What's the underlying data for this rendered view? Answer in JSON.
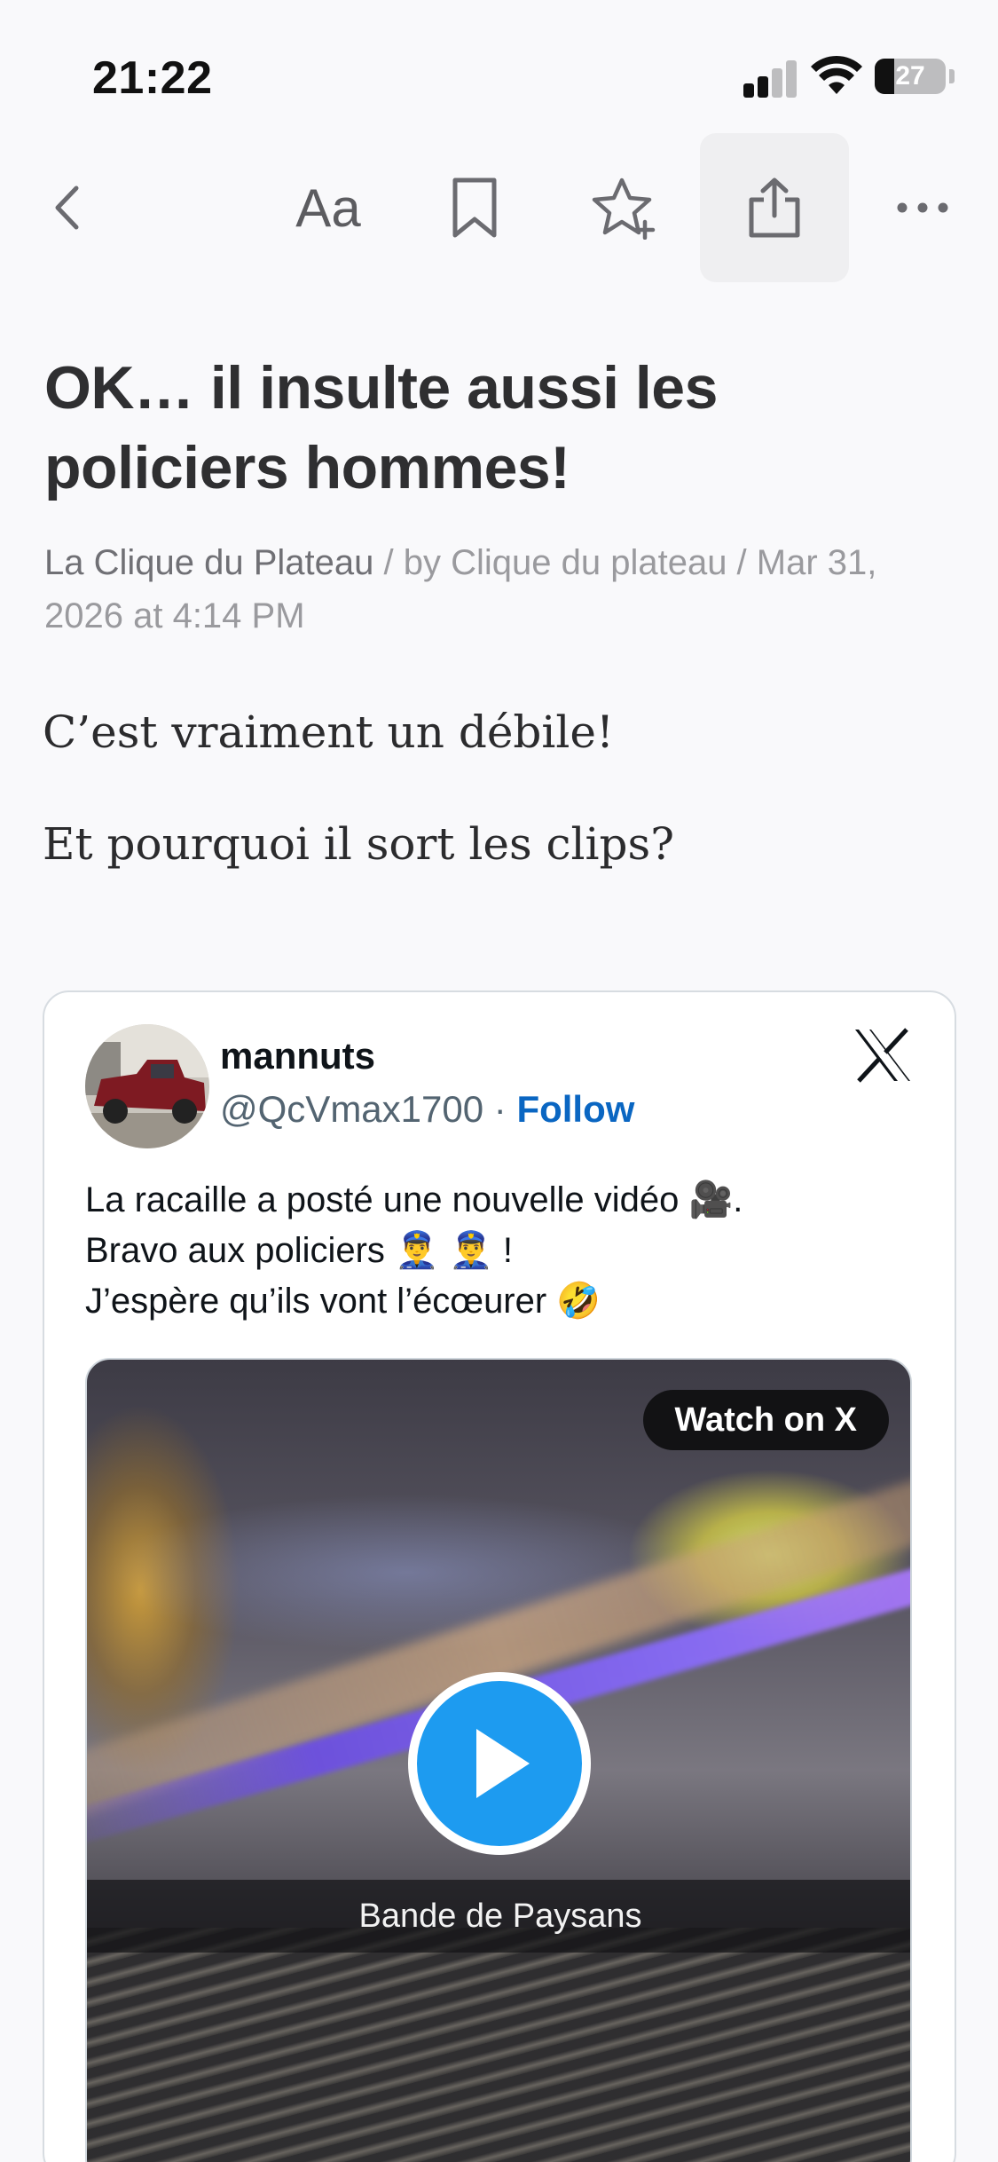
{
  "status_bar": {
    "time": "21:22",
    "battery_level": "27",
    "battery_fraction": 0.27
  },
  "toolbar": {
    "back_icon": "chevron-left-icon",
    "font_label": "Aa",
    "bookmark_icon": "bookmark-icon",
    "star_icon": "star-plus-icon",
    "share_icon": "share-icon",
    "more_icon": "ellipsis-icon"
  },
  "article": {
    "title": "OK… il insulte aussi les policiers hommes!",
    "source": "La Clique du Plateau",
    "meta_rest": " / by Clique du plateau / Mar 31, 2026 at 4:14 PM",
    "paragraphs": [
      "C’est vraiment un débile!",
      "Et pourquoi il sort les clips?"
    ]
  },
  "tweet": {
    "display_name": "mannuts",
    "handle": "@QcVmax1700",
    "separator": " · ",
    "follow_label": "Follow",
    "text_lines": [
      "La racaille a posté une nouvelle vidéo 🎥.",
      "Bravo aux policiers 👮‍♂️ 👮‍♂️ !",
      "J’espère qu’ils vont l’écœurer 🤣"
    ],
    "watch_label": "Watch on X",
    "video_caption": "Bande de Paysans"
  },
  "colors": {
    "background": "#f9f9fb",
    "accent_link": "#0a66c2",
    "play_button": "#1d9bf0"
  }
}
